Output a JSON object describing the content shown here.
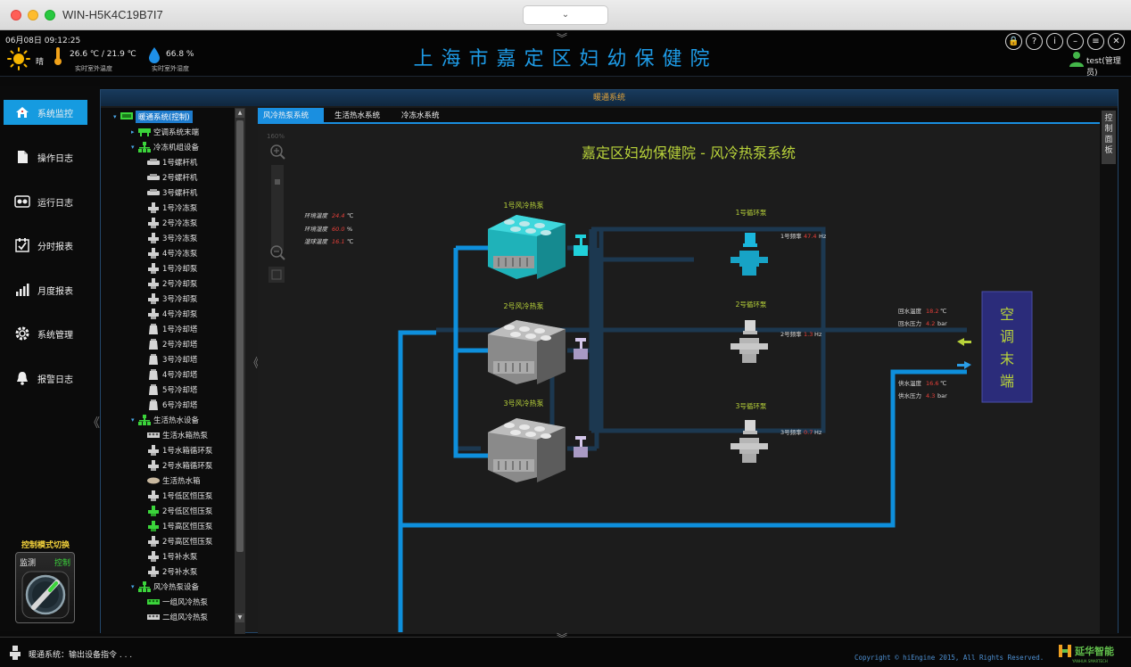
{
  "window": {
    "title": "WIN-H5K4C19B7I7",
    "dropdown_label": "⌄"
  },
  "header": {
    "datetime": "06月08日 09:12:25",
    "weather": "晴",
    "temperature": "26.6 ℃ / 21.9 ℃",
    "temperature_caption": "实时室外温度",
    "humidity": "66.8 %",
    "humidity_caption": "实时室外湿度",
    "title": "上海市嘉定区妇幼保健院",
    "user": "test(管理员)",
    "buttons": [
      "lock-icon",
      "help-icon",
      "info-icon",
      "minimize-icon",
      "menu-icon",
      "close-icon"
    ],
    "button_glyphs": [
      "🔒",
      "?",
      "i",
      "–",
      "≡",
      "✕"
    ]
  },
  "nav": {
    "items": [
      {
        "label": "系统监控",
        "icon": "home-icon",
        "active": true
      },
      {
        "label": "操作日志",
        "icon": "document-icon",
        "active": false
      },
      {
        "label": "运行日志",
        "icon": "log-icon",
        "active": false
      },
      {
        "label": "分时报表",
        "icon": "checklist-icon",
        "active": false
      },
      {
        "label": "月度报表",
        "icon": "bar-chart-icon",
        "active": false
      },
      {
        "label": "系统管理",
        "icon": "gear-icon",
        "active": false
      },
      {
        "label": "报警日志",
        "icon": "bell-icon",
        "active": false
      }
    ],
    "mode_title": "控制模式切换",
    "mode_monitor": "监测",
    "mode_control": "控制"
  },
  "panel": {
    "title": "暖通系统",
    "tree": [
      {
        "label": "暖通系统(控制)",
        "level": 0,
        "caret": "▾",
        "icon": "monitor-icon",
        "selected": true
      },
      {
        "label": "空调系统末端",
        "level": 1,
        "caret": "▸",
        "icon": "ahu-icon"
      },
      {
        "label": "冷冻机组设备",
        "level": 1,
        "caret": "▾",
        "icon": "hierarchy-icon"
      },
      {
        "label": "1号螺杆机",
        "level": 2,
        "icon": "chiller-icon"
      },
      {
        "label": "2号螺杆机",
        "level": 2,
        "icon": "chiller-icon"
      },
      {
        "label": "3号螺杆机",
        "level": 2,
        "icon": "chiller-icon"
      },
      {
        "label": "1号冷冻泵",
        "level": 2,
        "icon": "pump-icon"
      },
      {
        "label": "2号冷冻泵",
        "level": 2,
        "icon": "pump-icon"
      },
      {
        "label": "3号冷冻泵",
        "level": 2,
        "icon": "pump-icon"
      },
      {
        "label": "4号冷冻泵",
        "level": 2,
        "icon": "pump-icon"
      },
      {
        "label": "1号冷却泵",
        "level": 2,
        "icon": "pump-icon"
      },
      {
        "label": "2号冷却泵",
        "level": 2,
        "icon": "pump-icon"
      },
      {
        "label": "3号冷却泵",
        "level": 2,
        "icon": "pump-icon"
      },
      {
        "label": "4号冷却泵",
        "level": 2,
        "icon": "pump-icon"
      },
      {
        "label": "1号冷却塔",
        "level": 2,
        "icon": "tower-icon"
      },
      {
        "label": "2号冷却塔",
        "level": 2,
        "icon": "tower-icon"
      },
      {
        "label": "3号冷却塔",
        "level": 2,
        "icon": "tower-icon"
      },
      {
        "label": "4号冷却塔",
        "level": 2,
        "icon": "tower-icon"
      },
      {
        "label": "5号冷却塔",
        "level": 2,
        "icon": "tower-icon"
      },
      {
        "label": "6号冷却塔",
        "level": 2,
        "icon": "tower-icon"
      },
      {
        "label": "生活热水设备",
        "level": 1,
        "caret": "▾",
        "icon": "hierarchy-icon"
      },
      {
        "label": "生活水箱热泵",
        "level": 2,
        "icon": "heatpump-icon"
      },
      {
        "label": "1号水箱循环泵",
        "level": 2,
        "icon": "pump-icon"
      },
      {
        "label": "2号水箱循环泵",
        "level": 2,
        "icon": "pump-icon"
      },
      {
        "label": "生活热水箱",
        "level": 2,
        "icon": "tank-icon"
      },
      {
        "label": "1号低区恒压泵",
        "level": 2,
        "icon": "pump-icon"
      },
      {
        "label": "2号低区恒压泵",
        "level": 2,
        "icon": "pump-green-icon"
      },
      {
        "label": "1号高区恒压泵",
        "level": 2,
        "icon": "pump-green-icon"
      },
      {
        "label": "2号高区恒压泵",
        "level": 2,
        "icon": "pump-icon"
      },
      {
        "label": "1号补水泵",
        "level": 2,
        "icon": "pump-icon"
      },
      {
        "label": "2号补水泵",
        "level": 2,
        "icon": "pump-icon"
      },
      {
        "label": "风冷热泵设备",
        "level": 1,
        "caret": "▾",
        "icon": "hierarchy-icon"
      },
      {
        "label": "一组风冷热泵",
        "level": 2,
        "icon": "heatpump-green-icon"
      },
      {
        "label": "二组风冷热泵",
        "level": 2,
        "icon": "heatpump-icon"
      }
    ],
    "tabs": [
      {
        "label": "风冷热泵系统",
        "active": true
      },
      {
        "label": "生活热水系统",
        "active": false
      },
      {
        "label": "冷冻水系统",
        "active": false
      }
    ],
    "side_button": "控制面板"
  },
  "diagram": {
    "title": "嘉定区妇幼保健院 - 风冷热泵系统",
    "zoom": "160%",
    "env": [
      {
        "label": "环境温度",
        "value": "24.4",
        "unit": "℃"
      },
      {
        "label": "环境湿度",
        "value": "60.0",
        "unit": "%"
      },
      {
        "label": "湿球温度",
        "value": "16.1",
        "unit": "℃"
      }
    ],
    "heatpumps": [
      "1号风冷热泵",
      "2号风冷热泵",
      "3号风冷热泵"
    ],
    "pumps": [
      {
        "name": "1号循环泵",
        "freq_label": "1号频率",
        "freq": "47.4",
        "unit": "Hz"
      },
      {
        "name": "2号循环泵",
        "freq_label": "2号频率",
        "freq": "1.3",
        "unit": "Hz"
      },
      {
        "name": "3号循环泵",
        "freq_label": "3号频率",
        "freq": "0.7",
        "unit": "Hz"
      }
    ],
    "return_water": [
      {
        "label": "回水温度",
        "value": "18.2",
        "unit": "℃"
      },
      {
        "label": "回水压力",
        "value": "4.2",
        "unit": "bar"
      }
    ],
    "supply_water": [
      {
        "label": "供水温度",
        "value": "16.6",
        "unit": "℃"
      },
      {
        "label": "供水压力",
        "value": "4.3",
        "unit": "bar"
      }
    ],
    "terminal_lines": [
      "空",
      "调",
      "末",
      "端"
    ],
    "colors": {
      "active_pipe": "#0e8fdc",
      "inactive_pipe": "#1c3850",
      "teal_unit": "#20b3bc",
      "value_red": "#e8403a",
      "title_green": "#b9d33a"
    }
  },
  "status": {
    "message": "暖通系统：输出设备指令 . . .",
    "copyright": "Copyright © hiEngine 2015, All Rights Reserved.",
    "brand": "延华智能",
    "brand_sub": "YANHUA SMARTECH"
  }
}
